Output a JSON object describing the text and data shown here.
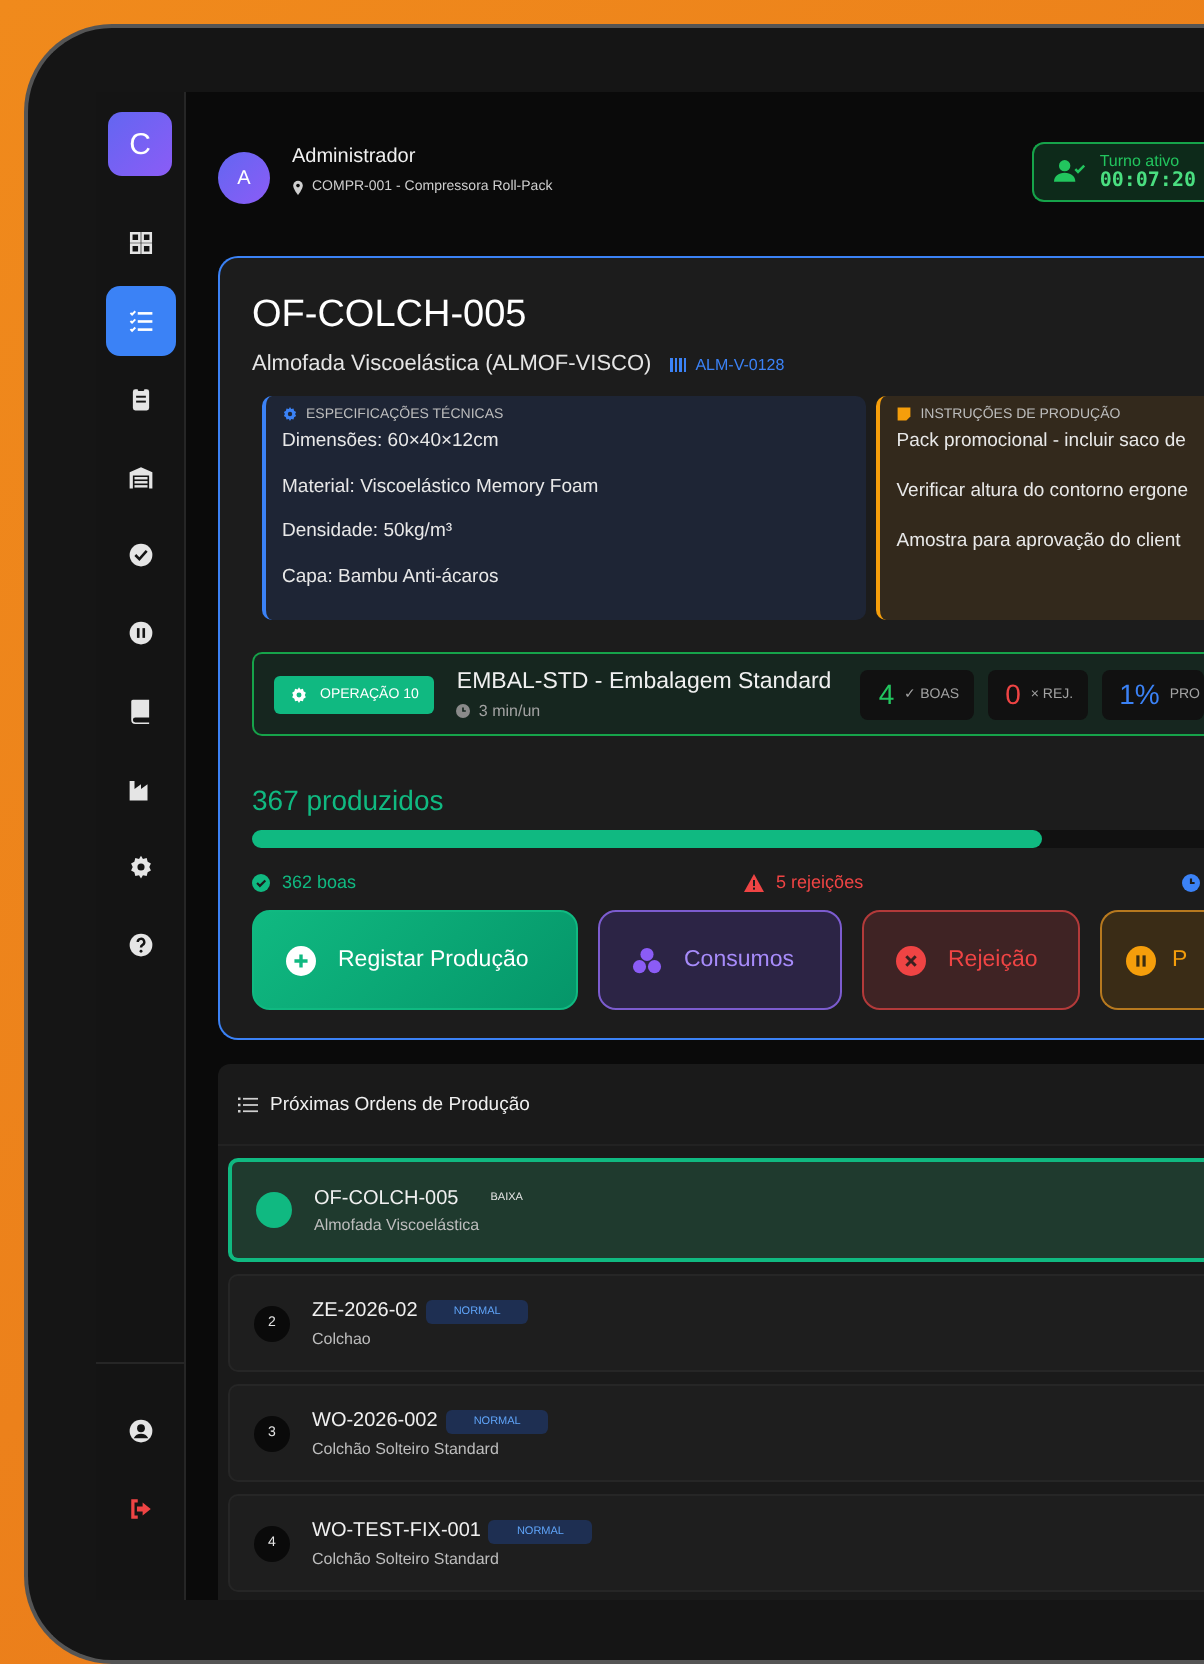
{
  "sidebar": {
    "logo": "C",
    "items": [
      {
        "selected": false
      },
      {
        "selected": true
      },
      {
        "selected": false
      },
      {
        "selected": false
      },
      {
        "selected": false
      },
      {
        "selected": false
      },
      {
        "selected": false
      },
      {
        "selected": false
      },
      {
        "selected": false
      },
      {
        "selected": false
      }
    ],
    "bottom_items": [
      {
        "kind": "user"
      },
      {
        "kind": "logout"
      }
    ]
  },
  "header": {
    "avatar": "A",
    "user": "Administrador",
    "machine": "COMPR-001 - Compressora Roll-Pack",
    "shift": {
      "label": "Turno ativo",
      "time": "00:07:20"
    }
  },
  "order": {
    "code": "OF-COLCH-005",
    "product": "Almofada Viscoelástica (ALMOF-VISCO)",
    "barcode": "ALM-V-0128",
    "specs": {
      "title": "ESPECIFICAÇÕES TÉCNICAS",
      "lines": [
        "Dimensões: 60×40×12cm",
        "Material: Viscoelástico Memory Foam",
        "Densidade: 50kg/m³",
        "Capa: Bambu Anti-ácaros"
      ]
    },
    "instructions": {
      "title": "INSTRUÇÕES DE PRODUÇÃO",
      "lines": [
        "Pack promocional - incluir saco de",
        "Verificar altura do contorno ergone",
        "Amostra para aprovação do client"
      ]
    },
    "operation": {
      "badge": "OPERAÇÃO 10",
      "name": "EMBAL-STD - Embalagem Standard",
      "time": "3 min/un",
      "stats": [
        {
          "kind": "good",
          "value": "4",
          "label": "✓ BOAS"
        },
        {
          "kind": "reject",
          "value": "0",
          "label": "× REJ."
        },
        {
          "kind": "progress",
          "value": "1%",
          "label": "PRO"
        }
      ]
    },
    "produced": "367 produzidos",
    "level": 0.83,
    "good": "362 boas",
    "rejects": "5 rejeições",
    "actions": [
      {
        "kind": "register",
        "label": "Registar Produção"
      },
      {
        "kind": "consume",
        "label": "Consumos"
      },
      {
        "kind": "reject",
        "label": "Rejeição"
      },
      {
        "kind": "pause",
        "label": "P"
      }
    ]
  },
  "queue": {
    "title": "Próximas Ordens de Produção",
    "rows": [
      {
        "selected": true,
        "code": "OF-COLCH-005",
        "priority": "BAIXA",
        "kind": "low",
        "product": "Almofada Viscoelástica"
      },
      {
        "selected": false,
        "number": "2",
        "code": "ZE-2026-02",
        "priority": "NORMAL",
        "kind": "normal",
        "product": "Colchao"
      },
      {
        "selected": false,
        "number": "3",
        "code": "WO-2026-002",
        "priority": "NORMAL",
        "kind": "normal",
        "product": "Colchão Solteiro Standard"
      },
      {
        "selected": false,
        "number": "4",
        "code": "WO-TEST-FIX-001",
        "priority": "NORMAL",
        "kind": "normal",
        "product": "Colchão Solteiro Standard"
      }
    ]
  }
}
